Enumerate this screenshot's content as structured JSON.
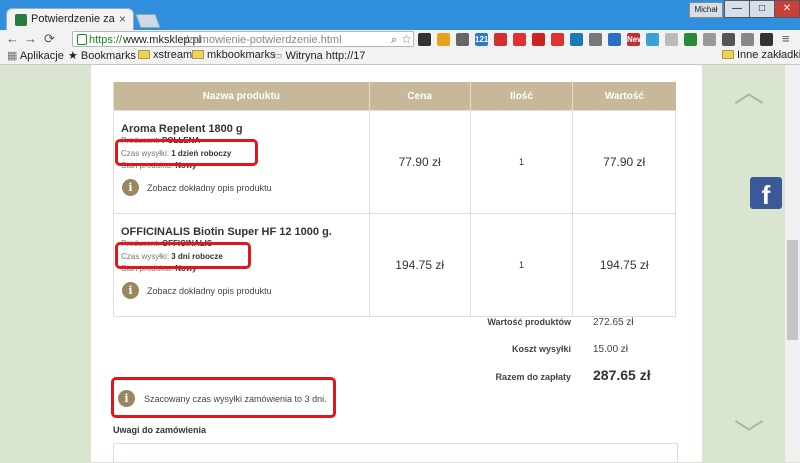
{
  "browser": {
    "tab_title": "Potwierdzenie zamó",
    "user": "Michał",
    "url_scheme": "https://",
    "url_host": "www.mksklep.pl",
    "url_path": "/zamowienie-potwierdzenie.html",
    "min_label": "—",
    "max_label": "□",
    "close_label": "✕",
    "tab_close": "×",
    "extensions": [
      "121",
      "New"
    ],
    "bookmarks": {
      "apps": "Aplikacje",
      "bookmarks": "Bookmarks",
      "xstream": "xstream",
      "mkbookmarks": "mkbookmarks",
      "witryna": "Witryna http://17",
      "other": "Inne zakładki"
    }
  },
  "table": {
    "headers": [
      "Nazwa produktu",
      "Cena",
      "Ilość",
      "Wartość"
    ],
    "rows": [
      {
        "name": "Aroma Repelent 1800 g",
        "producer_label": "Producent:",
        "producer": "POLLENA",
        "shipping_label": "Czas wysyłki:",
        "shipping": "1 dzień roboczy",
        "state_label": "Stan produktu:",
        "state": "Nowy",
        "desc_link": "Zobacz dokładny opis produktu",
        "price": "77.90 zł",
        "qty": "1",
        "total": "77.90 zł"
      },
      {
        "name": "OFFICINALIS Biotin Super HF 12 1000 g.",
        "producer_label": "Producent:",
        "producer": "OFFICINALIS",
        "shipping_label": "Czas wysyłki:",
        "shipping": "3 dni robocze",
        "state_label": "Stan produktu:",
        "state": "Nowy",
        "desc_link": "Zobacz dokładny opis produktu",
        "price": "194.75 zł",
        "qty": "1",
        "total": "194.75 zł"
      }
    ]
  },
  "summary": {
    "products_label": "Wartość produktów",
    "products_value": "272.65 zł",
    "shipping_label": "Koszt wysyłki",
    "shipping_value": "15.00 zł",
    "total_label": "Razem do zapłaty",
    "total_value": "287.65 zł"
  },
  "estimate_text": "Szacowany czas wysyłki zamówienia to 3 dni.",
  "notes_label": "Uwagi do zamówienia",
  "info_glyph": "i",
  "facebook_glyph": "f",
  "icons": {
    "up": "chevron-up-icon",
    "down": "chevron-down-icon",
    "facebook": "facebook-icon",
    "info": "info-icon"
  }
}
